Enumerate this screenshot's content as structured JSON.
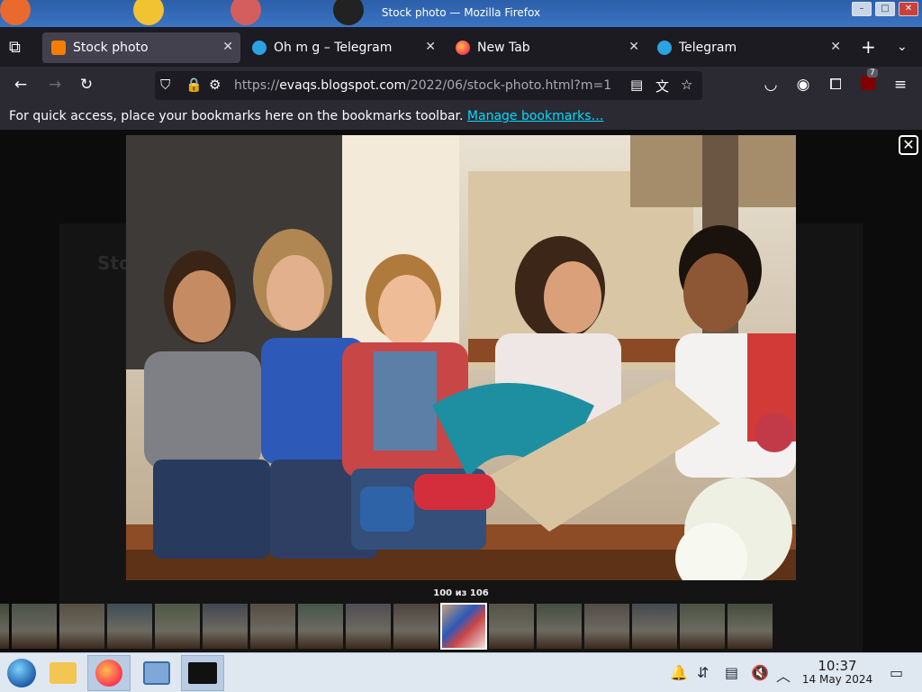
{
  "window": {
    "title": "Stock photo — Mozilla Firefox",
    "buttons": [
      "–",
      "□",
      "✕"
    ]
  },
  "tabs": [
    {
      "label": "Stock photo",
      "favicon": "blogger-icon",
      "color": "#f57d00",
      "active": true
    },
    {
      "label": "Oh m g – Telegram",
      "favicon": "telegram-icon",
      "color": "#2aa3e0",
      "active": false
    },
    {
      "label": "New Tab",
      "favicon": "firefox-icon",
      "color": "#ff7139",
      "active": false
    },
    {
      "label": "Telegram",
      "favicon": "telegram-icon",
      "color": "#2aa3e0",
      "active": false
    }
  ],
  "nav": {
    "url_prefix": "https://",
    "url_host": "evaqs.blogspot.com",
    "url_path": "/2022/06/stock-photo.html?m=1"
  },
  "bookmarks": {
    "message": "For quick access, place your bookmarks here on the bookmarks toolbar.",
    "link": "Manage bookmarks…"
  },
  "extensions_badge": "7",
  "lightbox": {
    "counter": "100 из 106",
    "background_text": [
      "Sto"
    ]
  },
  "taskbar": {
    "time": "10:37",
    "date": "14 May 2024",
    "apps": [
      "start-orb",
      "file-manager",
      "firefox",
      "control-panel",
      "terminal"
    ]
  },
  "colors": {
    "accent": "#00ddff",
    "tab_active": "#42414d",
    "page_bg": "#0c0c0d",
    "taskbar": "#dfe7f1"
  }
}
